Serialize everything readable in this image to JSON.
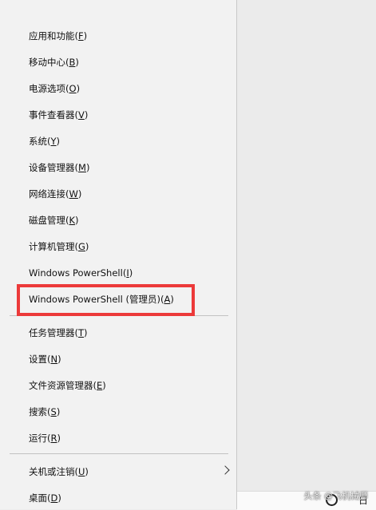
{
  "menu": {
    "items": [
      {
        "label": "应用和功能(",
        "key": "F",
        "close": ")"
      },
      {
        "label": "移动中心(",
        "key": "B",
        "close": ")"
      },
      {
        "label": "电源选项(",
        "key": "O",
        "close": ")"
      },
      {
        "label": "事件查看器(",
        "key": "V",
        "close": ")"
      },
      {
        "label": "系统(",
        "key": "Y",
        "close": ")"
      },
      {
        "label": "设备管理器(",
        "key": "M",
        "close": ")"
      },
      {
        "label": "网络连接(",
        "key": "W",
        "close": ")"
      },
      {
        "label": "磁盘管理(",
        "key": "K",
        "close": ")"
      },
      {
        "label": "计算机管理(",
        "key": "G",
        "close": ")"
      },
      {
        "label": "Windows PowerShell(",
        "key": "I",
        "close": ")"
      },
      {
        "label": "Windows PowerShell (管理员)(",
        "key": "A",
        "close": ")"
      },
      {
        "label": "任务管理器(",
        "key": "T",
        "close": ")"
      },
      {
        "label": "设置(",
        "key": "N",
        "close": ")"
      },
      {
        "label": "文件资源管理器(",
        "key": "E",
        "close": ")"
      },
      {
        "label": "搜索(",
        "key": "S",
        "close": ")"
      },
      {
        "label": "运行(",
        "key": "R",
        "close": ")"
      },
      {
        "label": "关机或注销(",
        "key": "U",
        "close": ")"
      },
      {
        "label": "桌面(",
        "key": "D",
        "close": ")"
      }
    ]
  },
  "highlight_color": "#ec3a3a",
  "watermark": "头条 @飞机械师",
  "taskbar_glyph": "日"
}
